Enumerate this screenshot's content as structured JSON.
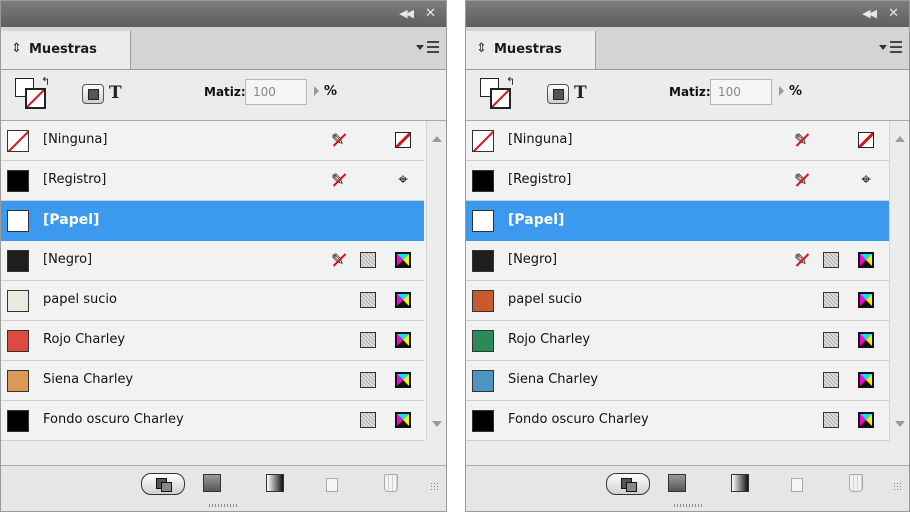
{
  "panels": [
    {
      "tab": "Muestras",
      "tint": {
        "label": "Matiz:",
        "value": "100",
        "unit": "%"
      },
      "swatches": [
        {
          "name": "[Ninguna]",
          "color": "none",
          "selected": false
        },
        {
          "name": "[Registro]",
          "color": "#000000",
          "selected": false
        },
        {
          "name": "[Papel]",
          "color": "#ffffff",
          "selected": true
        },
        {
          "name": "[Negro]",
          "color": "#1e1e1e",
          "selected": false
        },
        {
          "name": "papel sucio",
          "color": "#e9e9df",
          "selected": false
        },
        {
          "name": "Rojo Charley",
          "color": "#dd4a3f",
          "selected": false
        },
        {
          "name": "Siena Charley",
          "color": "#d99a58",
          "selected": false
        },
        {
          "name": "Fondo oscuro Charley",
          "color": "#000000",
          "selected": false
        }
      ]
    },
    {
      "tab": "Muestras",
      "tint": {
        "label": "Matiz:",
        "value": "100",
        "unit": "%"
      },
      "swatches": [
        {
          "name": "[Ninguna]",
          "color": "none",
          "selected": false
        },
        {
          "name": "[Registro]",
          "color": "#000000",
          "selected": false
        },
        {
          "name": "[Papel]",
          "color": "#ffffff",
          "selected": true
        },
        {
          "name": "[Negro]",
          "color": "#1e1e1e",
          "selected": false
        },
        {
          "name": "papel sucio",
          "color": "#c85a2e",
          "selected": false
        },
        {
          "name": "Rojo Charley",
          "color": "#2b8a57",
          "selected": false
        },
        {
          "name": "Siena Charley",
          "color": "#4b95c0",
          "selected": false
        },
        {
          "name": "Fondo oscuro Charley",
          "color": "#000000",
          "selected": false
        }
      ]
    }
  ],
  "colors": {
    "selection": "#3b99ee",
    "none_slash": "#e0101a"
  }
}
